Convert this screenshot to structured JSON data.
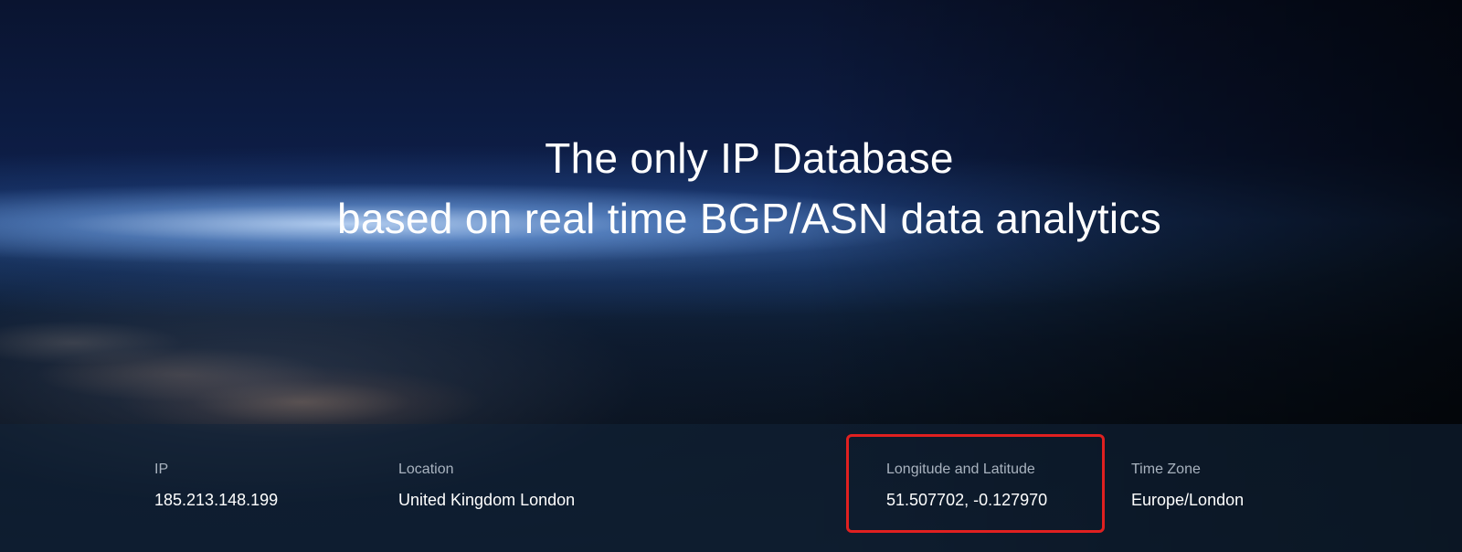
{
  "hero": {
    "headline_line1": "The only IP Database",
    "headline_line2": "based on real time BGP/ASN data analytics"
  },
  "info": {
    "ip": {
      "label": "IP",
      "value": "185.213.148.199"
    },
    "location": {
      "label": "Location",
      "value": "United Kingdom London"
    },
    "lonlat": {
      "label": "Longitude and Latitude",
      "value": "51.507702, -0.127970"
    },
    "timezone": {
      "label": "Time Zone",
      "value": "Europe/London"
    }
  },
  "colors": {
    "highlight_border": "#e02020",
    "label_text": "#a9b3bf",
    "value_text": "#ffffff"
  }
}
